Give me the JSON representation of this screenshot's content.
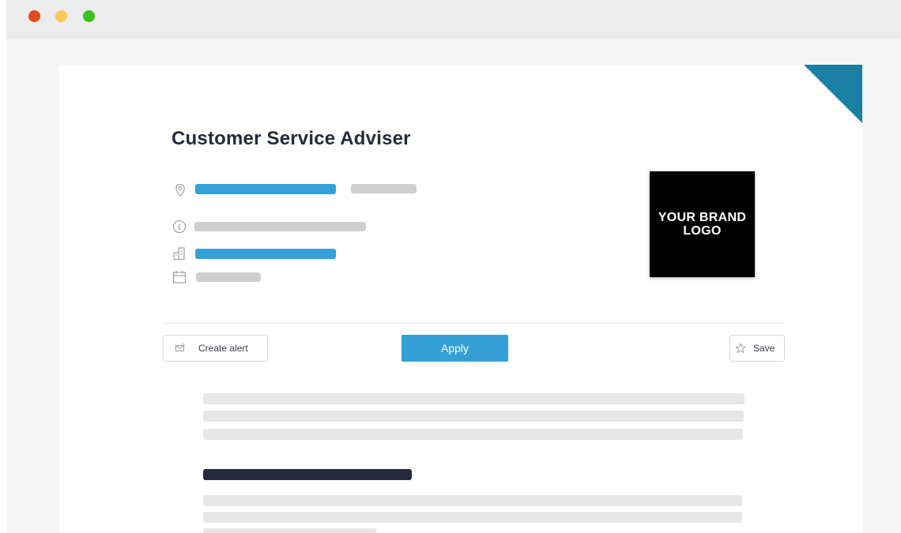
{
  "job": {
    "title": "Customer Service Adviser"
  },
  "brand_logo": {
    "text": "YOUR BRAND\nLOGO"
  },
  "actions": {
    "create_alert_label": "Create alert",
    "apply_label": "Apply",
    "save_label": "Save"
  },
  "icons": {
    "location": "location-pin-icon",
    "salary": "pound-coin-icon",
    "sector": "building-icon",
    "date": "calendar-icon",
    "alert": "envelope-alert-icon",
    "save": "star-icon"
  },
  "colors": {
    "accent_blue": "#34a0d6",
    "corner_teal": "#1a7fa2",
    "heading_dark": "#262a3a",
    "placeholder_grey": "#cfcfcf",
    "placeholder_light": "#e7e7e7",
    "traffic_red": "#e14b1f",
    "traffic_yellow": "#fcc85a",
    "traffic_green": "#38c21a"
  }
}
